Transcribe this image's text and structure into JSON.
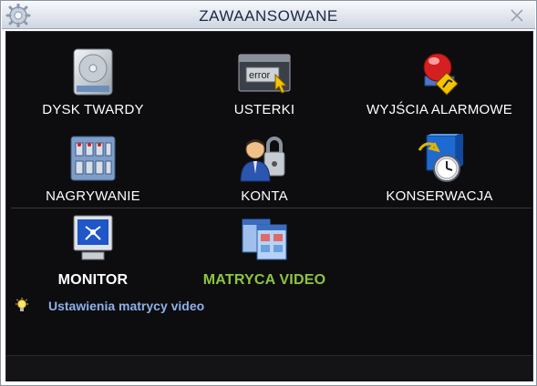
{
  "window": {
    "title": "ZAWAANSOWANE"
  },
  "menu": {
    "items": [
      {
        "label": "DYSK TWARDY",
        "icon": "hard-disk-icon"
      },
      {
        "label": "USTERKI",
        "icon": "error-icon"
      },
      {
        "label": "WYJŚCIA ALARMOWE",
        "icon": "alarm-output-icon"
      },
      {
        "label": "NAGRYWANIE",
        "icon": "recording-icon"
      },
      {
        "label": "KONTA",
        "icon": "accounts-icon"
      },
      {
        "label": "KONSERWACJA",
        "icon": "maintenance-icon"
      },
      {
        "label": "MONITOR",
        "icon": "monitor-icon"
      },
      {
        "label": "MATRYCA VIDEO",
        "icon": "video-matrix-icon"
      }
    ],
    "selected": "MATRYCA VIDEO",
    "error_icon_text": "error"
  },
  "status": {
    "hint": "Ustawienia matrycy video"
  },
  "colors": {
    "selected": "#8cc63f",
    "hint": "#8fb0ea",
    "background": "#0d0d0f"
  }
}
